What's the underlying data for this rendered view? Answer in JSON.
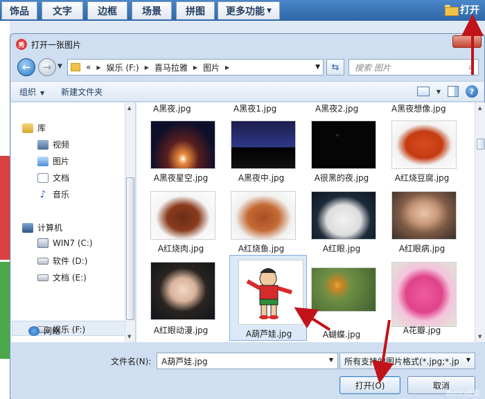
{
  "app_menu": {
    "items": [
      "饰品",
      "文字",
      "边框",
      "场景",
      "拼图",
      "更多功能"
    ],
    "open_label": "打开"
  },
  "dialog": {
    "title": "打开一张图片",
    "app_logo": "秀",
    "nav": {
      "breadcrumb": [
        "«",
        "娱乐 (F:)",
        "喜马拉雅",
        "图片"
      ],
      "search_placeholder": "搜索 图片"
    },
    "toolbar": {
      "organize": "组织",
      "new_folder": "新建文件夹"
    },
    "navpane": {
      "items": [
        {
          "label": "库",
          "icon": "library-icon"
        },
        {
          "label": "视频",
          "icon": "video-icon"
        },
        {
          "label": "图片",
          "icon": "pictures-icon"
        },
        {
          "label": "文档",
          "icon": "documents-icon"
        },
        {
          "label": "音乐",
          "icon": "music-icon"
        },
        {
          "label": "计算机",
          "icon": "computer-icon"
        },
        {
          "label": "WIN7 (C:)",
          "icon": "windows-drive-icon"
        },
        {
          "label": "软件 (D:)",
          "icon": "drive-icon"
        },
        {
          "label": "文档 (E:)",
          "icon": "drive-icon"
        },
        {
          "label": "娱乐 (F:)",
          "icon": "drive-icon"
        },
        {
          "label": "网络",
          "icon": "network-icon"
        }
      ]
    },
    "files": {
      "partial_row": [
        "A黑夜.jpg",
        "A黑夜1.jpg",
        "A黑夜2.jpg",
        "A黑夜想像.jpg"
      ],
      "tiles": [
        "A黑夜星空.jpg",
        "A黑夜中.jpg",
        "A很黑的夜.jpg",
        "A红烧豆腐.jpg",
        "A红烧肉.jpg",
        "A红烧鱼.jpg",
        "A红眼.jpg",
        "A红眼病.jpg",
        "A红眼动漫.jpg",
        "A葫芦娃.jpg",
        "A蝴蝶.jpg",
        "A花瓣.jpg"
      ],
      "selected": "A葫芦娃.jpg"
    },
    "bottom": {
      "filename_label": "文件名(N):",
      "filename_value": "A葫芦娃.jpg",
      "filetype_value": "所有支持的图片格式(*.jpg;*.jp",
      "open_button": "打开(O)",
      "cancel_button": "取消"
    }
  },
  "watermark": "Baidu经验",
  "colors": {
    "accent_blue": "#2e67a8",
    "arrow_red": "#c0141a",
    "selection": "#dbe9f8"
  }
}
